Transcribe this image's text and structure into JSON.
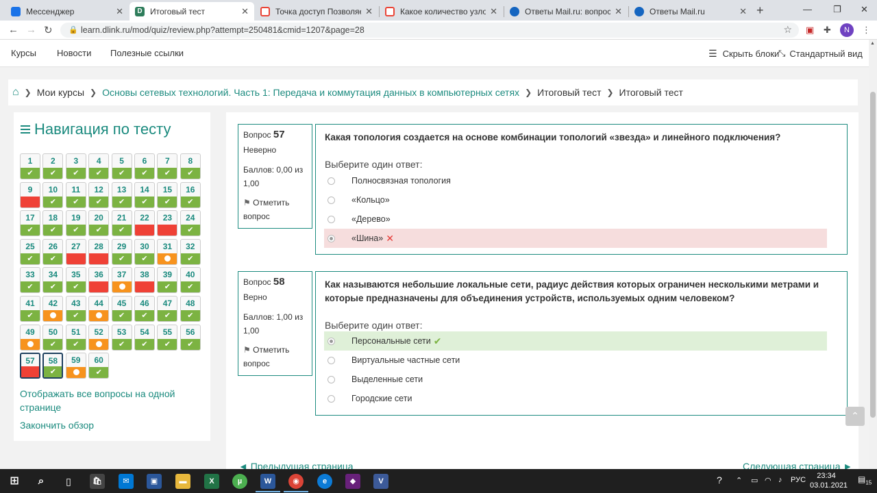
{
  "browser": {
    "tabs": [
      {
        "title": "Мессенджер",
        "color": "#1a73e8"
      },
      {
        "title": "Итоговый тест",
        "color": "#2e7d5b"
      },
      {
        "title": "Точка доступ Позволяет об",
        "color": "#ea4335"
      },
      {
        "title": "Какое количество узлов до",
        "color": "#ea4335"
      },
      {
        "title": "Ответы Mail.ru: вопрос",
        "color": "#1565c0"
      },
      {
        "title": "Ответы Mail.ru",
        "color": "#1565c0"
      }
    ],
    "url": "learn.dlink.ru/mod/quiz/review.php?attempt=250481&cmid=1207&page=28",
    "avatar": "N"
  },
  "topnav": {
    "links": [
      "Курсы",
      "Новости",
      "Полезные ссылки"
    ],
    "hide_blocks": "Скрыть блоки",
    "standard_view": "Стандартный вид"
  },
  "breadcrumb": {
    "my_courses": "Мои курсы",
    "course": "Основы сетевых технологий. Часть 1: Передача и коммутация данных в компьютерных сетях",
    "quiz": "Итоговый тест",
    "current": "Итоговый тест"
  },
  "quiz_nav": {
    "title": "Навигация по тесту",
    "questions": [
      {
        "n": "1",
        "s": "correct"
      },
      {
        "n": "2",
        "s": "correct"
      },
      {
        "n": "3",
        "s": "correct"
      },
      {
        "n": "4",
        "s": "correct"
      },
      {
        "n": "5",
        "s": "correct"
      },
      {
        "n": "6",
        "s": "correct"
      },
      {
        "n": "7",
        "s": "correct"
      },
      {
        "n": "8",
        "s": "correct"
      },
      {
        "n": "9",
        "s": "wrong"
      },
      {
        "n": "10",
        "s": "correct"
      },
      {
        "n": "11",
        "s": "correct"
      },
      {
        "n": "12",
        "s": "correct"
      },
      {
        "n": "13",
        "s": "correct"
      },
      {
        "n": "14",
        "s": "correct"
      },
      {
        "n": "15",
        "s": "correct"
      },
      {
        "n": "16",
        "s": "correct"
      },
      {
        "n": "17",
        "s": "correct"
      },
      {
        "n": "18",
        "s": "correct"
      },
      {
        "n": "19",
        "s": "correct"
      },
      {
        "n": "20",
        "s": "correct"
      },
      {
        "n": "21",
        "s": "correct"
      },
      {
        "n": "22",
        "s": "wrong"
      },
      {
        "n": "23",
        "s": "wrong"
      },
      {
        "n": "24",
        "s": "correct"
      },
      {
        "n": "25",
        "s": "correct"
      },
      {
        "n": "26",
        "s": "correct"
      },
      {
        "n": "27",
        "s": "wrong"
      },
      {
        "n": "28",
        "s": "wrong"
      },
      {
        "n": "29",
        "s": "correct"
      },
      {
        "n": "30",
        "s": "correct"
      },
      {
        "n": "31",
        "s": "partial"
      },
      {
        "n": "32",
        "s": "correct"
      },
      {
        "n": "33",
        "s": "correct"
      },
      {
        "n": "34",
        "s": "correct"
      },
      {
        "n": "35",
        "s": "correct"
      },
      {
        "n": "36",
        "s": "wrong"
      },
      {
        "n": "37",
        "s": "partial"
      },
      {
        "n": "38",
        "s": "wrong"
      },
      {
        "n": "39",
        "s": "correct"
      },
      {
        "n": "40",
        "s": "correct"
      },
      {
        "n": "41",
        "s": "correct"
      },
      {
        "n": "42",
        "s": "partial"
      },
      {
        "n": "43",
        "s": "correct"
      },
      {
        "n": "44",
        "s": "partial"
      },
      {
        "n": "45",
        "s": "correct"
      },
      {
        "n": "46",
        "s": "correct"
      },
      {
        "n": "47",
        "s": "correct"
      },
      {
        "n": "48",
        "s": "correct"
      },
      {
        "n": "49",
        "s": "partial"
      },
      {
        "n": "50",
        "s": "correct"
      },
      {
        "n": "51",
        "s": "correct"
      },
      {
        "n": "52",
        "s": "partial"
      },
      {
        "n": "53",
        "s": "correct"
      },
      {
        "n": "54",
        "s": "correct"
      },
      {
        "n": "55",
        "s": "correct"
      },
      {
        "n": "56",
        "s": "correct"
      },
      {
        "n": "57",
        "s": "wrong",
        "current": true
      },
      {
        "n": "58",
        "s": "correct",
        "current": true
      },
      {
        "n": "59",
        "s": "partial"
      },
      {
        "n": "60",
        "s": "correct"
      }
    ],
    "show_all": "Отображать все вопросы на одной странице",
    "finish": "Закончить обзор"
  },
  "questions": [
    {
      "label": "Вопрос",
      "number": "57",
      "state": "Неверно",
      "grade": "Баллов: 0,00 из 1,00",
      "flag": "Отметить вопрос",
      "text": "Какая топология создается на основе комбинации топологий «звезда» и линейного подключения?",
      "prompt": "Выберите один ответ:",
      "answers": [
        {
          "label": "Полносвязная топология",
          "state": ""
        },
        {
          "label": "«Кольцо»",
          "state": ""
        },
        {
          "label": "«Дерево»",
          "state": ""
        },
        {
          "label": "«Шина»",
          "state": "bad"
        }
      ]
    },
    {
      "label": "Вопрос",
      "number": "58",
      "state": "Верно",
      "grade": "Баллов: 1,00 из 1,00",
      "flag": "Отметить вопрос",
      "text": "Как называются небольшие локальные сети, радиус действия которых ограничен несколькими метрами и которые предназначены для объединения устройств, используемых одним человеком?",
      "prompt": "Выберите один ответ:",
      "answers": [
        {
          "label": "Персональные сети",
          "state": "good"
        },
        {
          "label": "Виртуальные частные сети",
          "state": ""
        },
        {
          "label": "Выделенные сети",
          "state": ""
        },
        {
          "label": "Городские сети",
          "state": ""
        }
      ]
    }
  ],
  "pager": {
    "prev": "◄ Предыдущая страница",
    "next": "Следующая страница ►"
  },
  "taskbar": {
    "lang": "РУС",
    "time": "23:34",
    "date": "03.01.2021",
    "notifications": "15"
  },
  "colors": {
    "accent": "#1a8a7e",
    "correct": "#7cb342",
    "wrong": "#ef4136",
    "partial": "#f7931e"
  }
}
